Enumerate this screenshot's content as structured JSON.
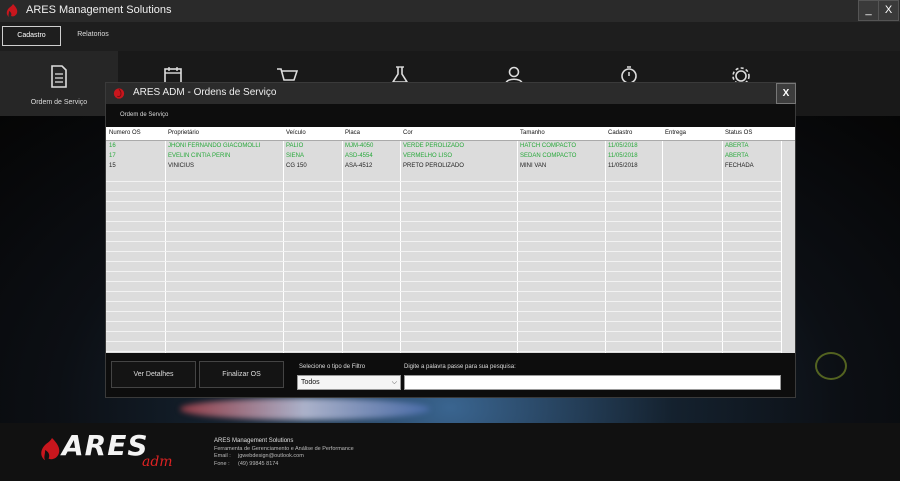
{
  "window": {
    "title": "ARES Management Solutions",
    "minimize_label": "_",
    "close_label": "X"
  },
  "menu": {
    "items": [
      {
        "label": "Cadastro"
      },
      {
        "label": "Relatorios"
      }
    ]
  },
  "toolbar": {
    "items": [
      {
        "icon": "document-icon",
        "label": "Ordem de Serviço"
      },
      {
        "icon": "calendar-icon",
        "label": ""
      },
      {
        "icon": "shopping-cart-icon",
        "label": ""
      },
      {
        "icon": "flask-icon",
        "label": ""
      },
      {
        "icon": "user-icon",
        "label": ""
      },
      {
        "icon": "stopwatch-icon",
        "label": ""
      },
      {
        "icon": "gear-icon",
        "label": ""
      }
    ]
  },
  "modal": {
    "title": "ARES ADM - Ordens de Serviço",
    "close_label": "X",
    "tab_label": "Ordem de Serviço",
    "columns": [
      "Numero OS",
      "Proprietário",
      "Veículo",
      "Placa",
      "Cor",
      "Tamanho",
      "Cadastro",
      "Entrega",
      "Status OS"
    ],
    "rows": [
      {
        "numero": "16",
        "proprietario": "JHONI FERNANDO GIACOMOLLI",
        "veiculo": "PALIO",
        "placa": "MJM-4050",
        "cor": "VERDE PEROLIZADO",
        "tamanho": "HATCH COMPACTO",
        "cadastro": "11/05/2018",
        "entrega": "",
        "status": "ABERTA"
      },
      {
        "numero": "17",
        "proprietario": "EVELIN CINTIA PERIN",
        "veiculo": "SIENA",
        "placa": "ASD-4554",
        "cor": "VERMELHO LISO",
        "tamanho": "SEDAN COMPACTO",
        "cadastro": "11/05/2018",
        "entrega": "",
        "status": "ABERTA"
      },
      {
        "numero": "15",
        "proprietario": "VINICIUS",
        "veiculo": "CG 150",
        "placa": "ASA-4512",
        "cor": "PRETO PEROLIZADO",
        "tamanho": "MINI VAN",
        "cadastro": "11/05/2018",
        "entrega": "",
        "status": "FECHADA"
      }
    ],
    "details_button": "Ver Detalhes",
    "finish_button": "Finalizar OS",
    "filter_label": "Selecione o tipo de Filtro",
    "filter_value": "Todos",
    "search_label": "Digite a palavra passe para sua pesquisa:",
    "search_value": ""
  },
  "footer": {
    "brand": "ARES",
    "brand_sub": "adm",
    "company": "ARES Management Solutions",
    "tagline": "Ferramenta de Gerenciamento e Análise de Performance",
    "email_label": "Email :",
    "email": "jgwebdesign@outlook.com",
    "phone_label": "Fone :",
    "phone": "(49) 99845 8174"
  },
  "colors": {
    "open_status": "#27a83a",
    "closed_status": "#222222",
    "accent_red": "#c8161d"
  }
}
